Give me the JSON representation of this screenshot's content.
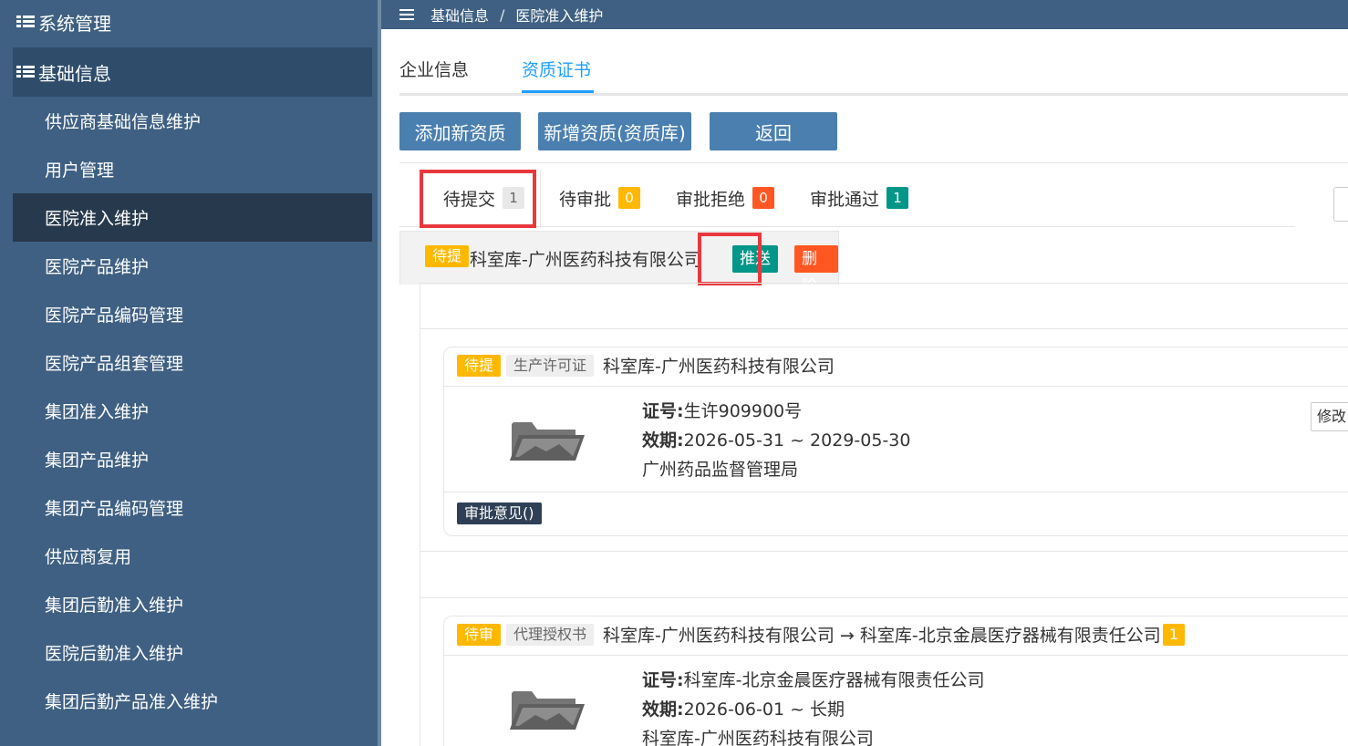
{
  "sidebar": {
    "groups": [
      {
        "label": "系统管理"
      },
      {
        "label": "基础信息"
      }
    ],
    "items": [
      {
        "label": "供应商基础信息维护"
      },
      {
        "label": "用户管理"
      },
      {
        "label": "医院准入维护"
      },
      {
        "label": "医院产品维护"
      },
      {
        "label": "医院产品编码管理"
      },
      {
        "label": "医院产品组套管理"
      },
      {
        "label": "集团准入维护"
      },
      {
        "label": "集团产品维护"
      },
      {
        "label": "集团产品编码管理"
      },
      {
        "label": "供应商复用"
      },
      {
        "label": "集团后勤准入维护"
      },
      {
        "label": "医院后勤准入维护"
      },
      {
        "label": "集团后勤产品准入维护"
      }
    ],
    "active_item": "医院准入维护"
  },
  "breadcrumb": {
    "menu_icon": "hamburger-icon",
    "parent": "基础信息",
    "separator": "/",
    "current": "医院准入维护"
  },
  "tabs": [
    {
      "label": "企业信息",
      "active": false
    },
    {
      "label": "资质证书",
      "active": true
    }
  ],
  "toolbar": {
    "add_label": "添加新资质",
    "add_lib_label": "新增资质(资质库)",
    "back_label": "返回"
  },
  "status_tabs": [
    {
      "label": "待提交",
      "count": "1",
      "badge_color": "#e8e8e8"
    },
    {
      "label": "待审批",
      "count": "0",
      "badge_color": "#ffb800"
    },
    {
      "label": "审批拒绝",
      "count": "0",
      "badge_color": "#ff5722"
    },
    {
      "label": "审批通过",
      "count": "1",
      "badge_color": "#009688"
    }
  ],
  "panel": {
    "status_tag": "待提",
    "title": "科室库-广州医药科技有限公司",
    "push_label": "推送",
    "delete_label": "删除"
  },
  "cards": [
    {
      "status_tag": "待提",
      "type_tag": "生产许可证",
      "title": "科室库-广州医药科技有限公司",
      "number_label": "证号:",
      "number_value": "生许909900号",
      "validity_label": "效期:",
      "validity_value": "2026-05-31 ~ 2029-05-30",
      "issuer": "广州药品监督管理局",
      "edit_label": "修改",
      "approval_label": "审批意见()"
    },
    {
      "status_tag": "待审",
      "type_tag": "代理授权书",
      "title": "科室库-广州医药科技有限公司 → 科室库-北京金晨医疗器械有限责任公司",
      "title_badge": "1",
      "number_label": "证号:",
      "number_value": "科室库-北京金晨医疗器械有限责任公司",
      "validity_label": "效期:",
      "validity_value": "2026-06-01 ~ 长期",
      "issuer": "科室库-广州医药科技有限公司"
    }
  ],
  "colors": {
    "sidebar_bg": "#3f6082",
    "sidebar_active": "#27394d",
    "button_blue": "#4a7fb0",
    "tab_active": "#1e9fff",
    "highlight_red": "#e8383d"
  }
}
